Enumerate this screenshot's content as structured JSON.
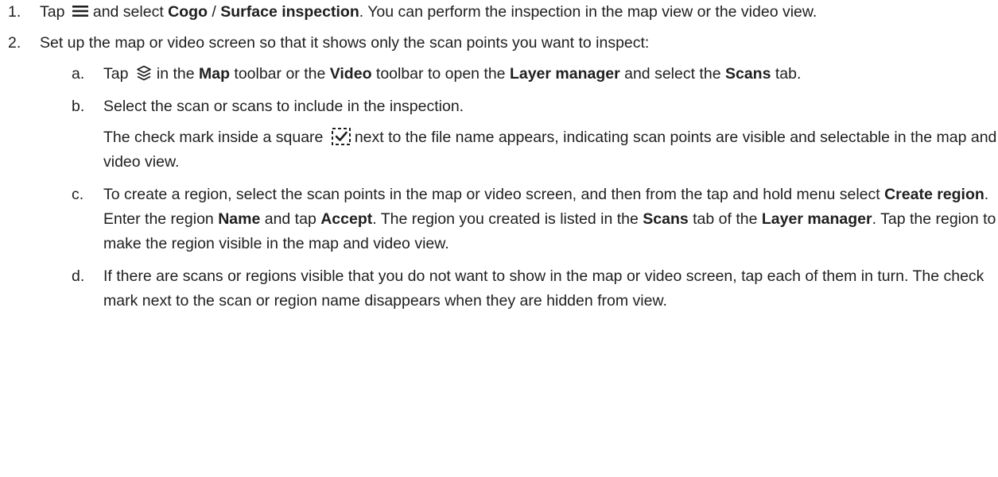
{
  "steps": [
    {
      "num": "1.",
      "parts": [
        {
          "t": "Tap "
        },
        {
          "icon": "menu-icon"
        },
        {
          "t": "and select "
        },
        {
          "b": "Cogo"
        },
        {
          "t": " / "
        },
        {
          "b": "Surface inspection"
        },
        {
          "t": ". You can perform the inspection in the map view or the video view."
        }
      ]
    },
    {
      "num": "2.",
      "parts": [
        {
          "t": "Set up the map or video screen so that it shows only the scan points you want to inspect:"
        }
      ],
      "substeps": [
        {
          "letter": "a.",
          "parts": [
            {
              "t": "Tap "
            },
            {
              "icon": "layers-icon"
            },
            {
              "t": "in the "
            },
            {
              "b": "Map"
            },
            {
              "t": " toolbar or the "
            },
            {
              "b": "Video"
            },
            {
              "t": " toolbar to open the "
            },
            {
              "b": "Layer manager"
            },
            {
              "t": " and select the "
            },
            {
              "b": "Scans"
            },
            {
              "t": " tab."
            }
          ]
        },
        {
          "letter": "b.",
          "parts": [
            {
              "t": "Select the scan or scans to include in the inspection."
            }
          ],
          "note": [
            {
              "t": "The check mark inside a square "
            },
            {
              "icon": "checkbox-icon"
            },
            {
              "t": "next to the file name appears, indicating scan points are visible and selectable in the map and video view."
            }
          ]
        },
        {
          "letter": "c.",
          "parts": [
            {
              "t": "To create a region, select the scan points in the map or video screen, and then from the tap and hold menu select "
            },
            {
              "b": "Create region"
            },
            {
              "t": ". Enter the region "
            },
            {
              "b": "Name"
            },
            {
              "t": " and tap "
            },
            {
              "b": "Accept"
            },
            {
              "t": ". The region you created is listed in the "
            },
            {
              "b": "Scans"
            },
            {
              "t": " tab of the "
            },
            {
              "b": "Layer manager"
            },
            {
              "t": ". Tap the region to make the region visible in the map and video view."
            }
          ]
        },
        {
          "letter": "d.",
          "parts": [
            {
              "t": "If there are scans or regions visible that you do not want to show in the map or video screen, tap each of them in turn. The check mark next to the scan or region name disappears when they are hidden from view."
            }
          ]
        }
      ]
    }
  ]
}
